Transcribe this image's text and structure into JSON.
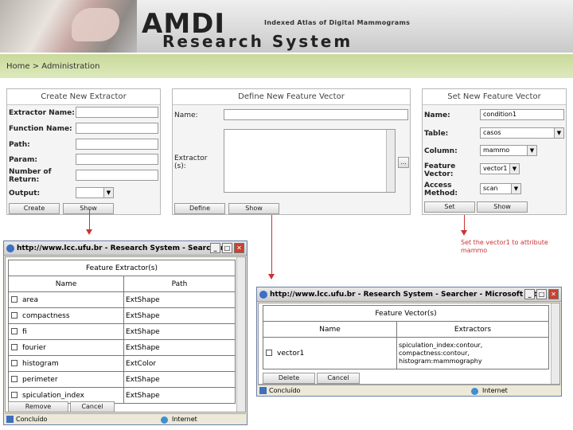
{
  "banner": {
    "title": "AMDI",
    "subtitle": "Indexed Atlas of Digital Mammograms",
    "title2": "Research System"
  },
  "breadcrumb": {
    "home": "Home",
    "sep": " > ",
    "current": "Administration"
  },
  "extractor_panel": {
    "header": "Create New Extractor",
    "labels": [
      "Extractor Name:",
      "Function Name:",
      "Path:",
      "Param:",
      "Number of Return:",
      "Output:"
    ],
    "create_button": "Create",
    "show_button": "Show"
  },
  "feature_panel": {
    "header": "Define New Feature Vector",
    "name_label": "Name:",
    "extractor_label": "Extractor (s):",
    "browse_button": "...",
    "define_button": "Define",
    "show_button": "Show"
  },
  "set_panel": {
    "header": "Set New Feature Vector",
    "name_label": "Name:",
    "name_value": "condition1",
    "table_label": "Table:",
    "table_value": "casos",
    "column_label": "Column:",
    "column_value": "mammo",
    "vector_label": "Feature Vector:",
    "vector_value": "vector1",
    "access_label": "Access Method:",
    "access_value": "scan",
    "set_button": "Set",
    "show_button": "Show"
  },
  "annotation": "Set the vector1 to attribute mammo",
  "win1": {
    "title": "http://www.lcc.ufu.br - Research System - Searcher...",
    "table_title": "Feature Extractor(s)",
    "col_name": "Name",
    "col_path": "Path",
    "rows": [
      {
        "name": "area",
        "path": "ExtShape"
      },
      {
        "name": "compactness",
        "path": "ExtShape"
      },
      {
        "name": "fi",
        "path": "ExtShape"
      },
      {
        "name": "fourier",
        "path": "ExtShape"
      },
      {
        "name": "histogram",
        "path": "ExtColor"
      },
      {
        "name": "perimeter",
        "path": "ExtShape"
      },
      {
        "name": "spiculation_index",
        "path": "ExtShape"
      }
    ],
    "remove_button": "Remove",
    "cancel_button": "Cancel",
    "status_left": "Concluído",
    "status_right": "Internet"
  },
  "win2": {
    "title": "http://www.lcc.ufu.br - Research System - Searcher - Microsoft Int...",
    "table_title": "Feature Vector(s)",
    "col_name": "Name",
    "col_extractors": "Extractors",
    "rows": [
      {
        "name": "vector1",
        "extractors": [
          "spiculation_index:contour,",
          "compactness:contour,",
          "histogram:mammography"
        ]
      }
    ],
    "delete_button": "Delete",
    "cancel_button": "Cancel",
    "status_left": "Concluído",
    "status_right": "Internet"
  }
}
